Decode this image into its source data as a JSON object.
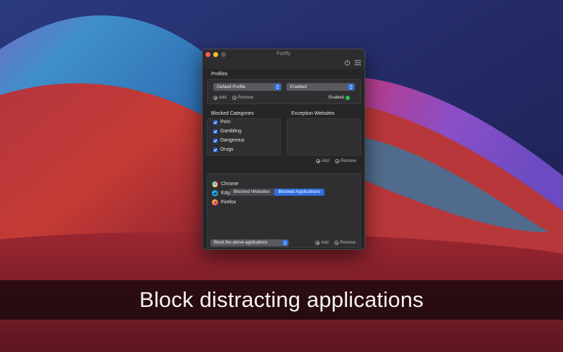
{
  "banner": {
    "caption": "Block distracting applications"
  },
  "window": {
    "title": "Fortify",
    "toolbar": {
      "power": "power-icon",
      "menu": "menu-icon"
    }
  },
  "profiles": {
    "label": "Profiles",
    "profile_select": {
      "value": "Default Profile"
    },
    "state_select": {
      "value": "Enabled"
    },
    "add_label": "Add",
    "remove_label": "Remove",
    "status_label": "Enabled",
    "status_color": "#2fc84a"
  },
  "blocked_categories": {
    "label": "Blocked Categories",
    "items": [
      {
        "label": "Porn",
        "checked": true
      },
      {
        "label": "Gambling",
        "checked": true
      },
      {
        "label": "Dangerous",
        "checked": true
      },
      {
        "label": "Drugs",
        "checked": true
      }
    ]
  },
  "exception_websites": {
    "label": "Exception Websites",
    "add_label": "Add",
    "remove_label": "Remove"
  },
  "tabs": [
    {
      "label": "Blocked Websites",
      "active": false
    },
    {
      "label": "Blocked Applications",
      "active": true
    }
  ],
  "applications": {
    "items": [
      {
        "name": "Chrome",
        "icon": "chrome-icon"
      },
      {
        "name": "Edge",
        "icon": "edge-icon"
      },
      {
        "name": "Firefox",
        "icon": "firefox-icon"
      }
    ],
    "mode_select": {
      "value": "Block the above applications"
    },
    "add_label": "Add",
    "remove_label": "Remove"
  },
  "colors": {
    "accent": "#2f6fe0",
    "close": "#fe5f57",
    "minimize": "#febc2e"
  }
}
